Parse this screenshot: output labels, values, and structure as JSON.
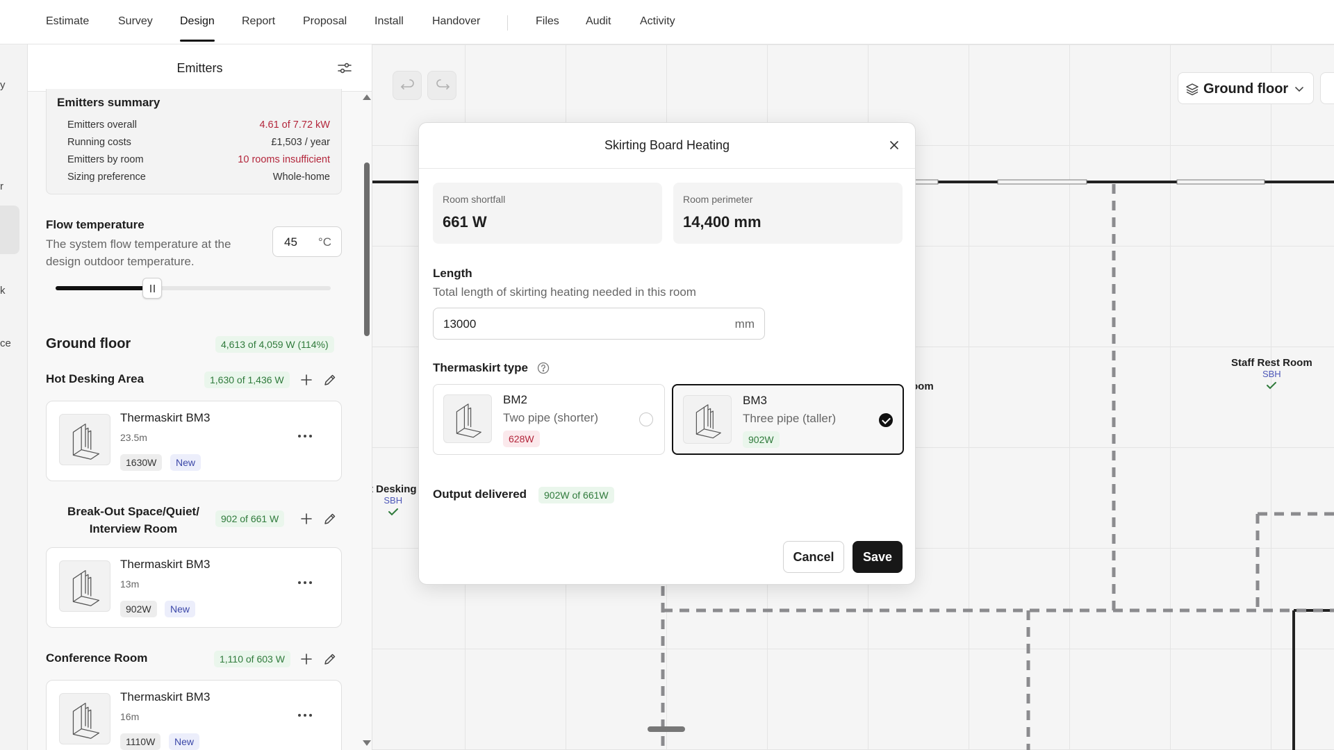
{
  "nav": {
    "tabs": [
      "Estimate",
      "Survey",
      "Design",
      "Report",
      "Proposal",
      "Install",
      "Handover"
    ],
    "secondary_tabs": [
      "Files",
      "Audit",
      "Activity"
    ],
    "active_tab": "Design"
  },
  "rail": {
    "fragments": [
      "y",
      "r",
      "k",
      "ce"
    ]
  },
  "sidebar": {
    "title": "Emitters",
    "summary": {
      "heading": "Emitters summary",
      "rows": [
        {
          "label": "Emitters overall",
          "value": "4.61 of 7.72 kW"
        },
        {
          "label": "Running costs",
          "value": "£1,503 / year"
        },
        {
          "label": "Emitters by room",
          "value": "10 rooms insufficient"
        },
        {
          "label": "Sizing preference",
          "value": "Whole-home"
        }
      ]
    },
    "flow": {
      "title": "Flow temperature",
      "description": "The system flow temperature at the design outdoor temperature.",
      "value": "45",
      "unit": "°C",
      "slider_fraction": 0.33
    },
    "floor": {
      "title": "Ground floor",
      "badge": "4,613 of 4,059 W (114%)"
    },
    "rooms": [
      {
        "name": "Hot Desking Area",
        "badge": "1,630 of 1,436 W",
        "emitter": {
          "name": "Thermaskirt BM3",
          "length": "23.5m",
          "power": "1630W",
          "tag": "New"
        }
      },
      {
        "name": "Break-Out Space/Quiet/\nInterview Room",
        "badge": "902 of 661 W",
        "emitter": {
          "name": "Thermaskirt BM3",
          "length": "13m",
          "power": "902W",
          "tag": "New"
        }
      },
      {
        "name": "Conference Room",
        "badge": "1,110 of 603 W",
        "emitter": {
          "name": "Thermaskirt BM3",
          "length": "16m",
          "power": "1110W",
          "tag": "New"
        }
      }
    ]
  },
  "canvas": {
    "floor_select": "Ground floor",
    "rooms": [
      {
        "name": "Staff Rest Room",
        "tag": "SBH"
      },
      {
        "name": "t Desking",
        "tag": "SBH"
      },
      {
        "name": "oom"
      }
    ]
  },
  "modal": {
    "title": "Skirting Board Heating",
    "shortfall": {
      "label": "Room shortfall",
      "value": "661 W"
    },
    "perimeter": {
      "label": "Room perimeter",
      "value": "14,400 mm"
    },
    "length": {
      "label": "Length",
      "description": "Total length of skirting heating needed in this room",
      "value": "13000",
      "unit": "mm"
    },
    "type_label": "Thermaskirt type",
    "options": [
      {
        "code": "BM2",
        "description": "Two pipe (shorter)",
        "power": "628W",
        "selected": false
      },
      {
        "code": "BM3",
        "description": "Three pipe (taller)",
        "power": "902W",
        "selected": true
      }
    ],
    "output": {
      "label": "Output delivered",
      "value": "902W of 661W"
    },
    "cancel": "Cancel",
    "save": "Save"
  },
  "colors": {
    "accent": "#171717",
    "warning": "#b3263b",
    "ok": "#2f7a3b",
    "tag_blue": "#3b47a8"
  }
}
